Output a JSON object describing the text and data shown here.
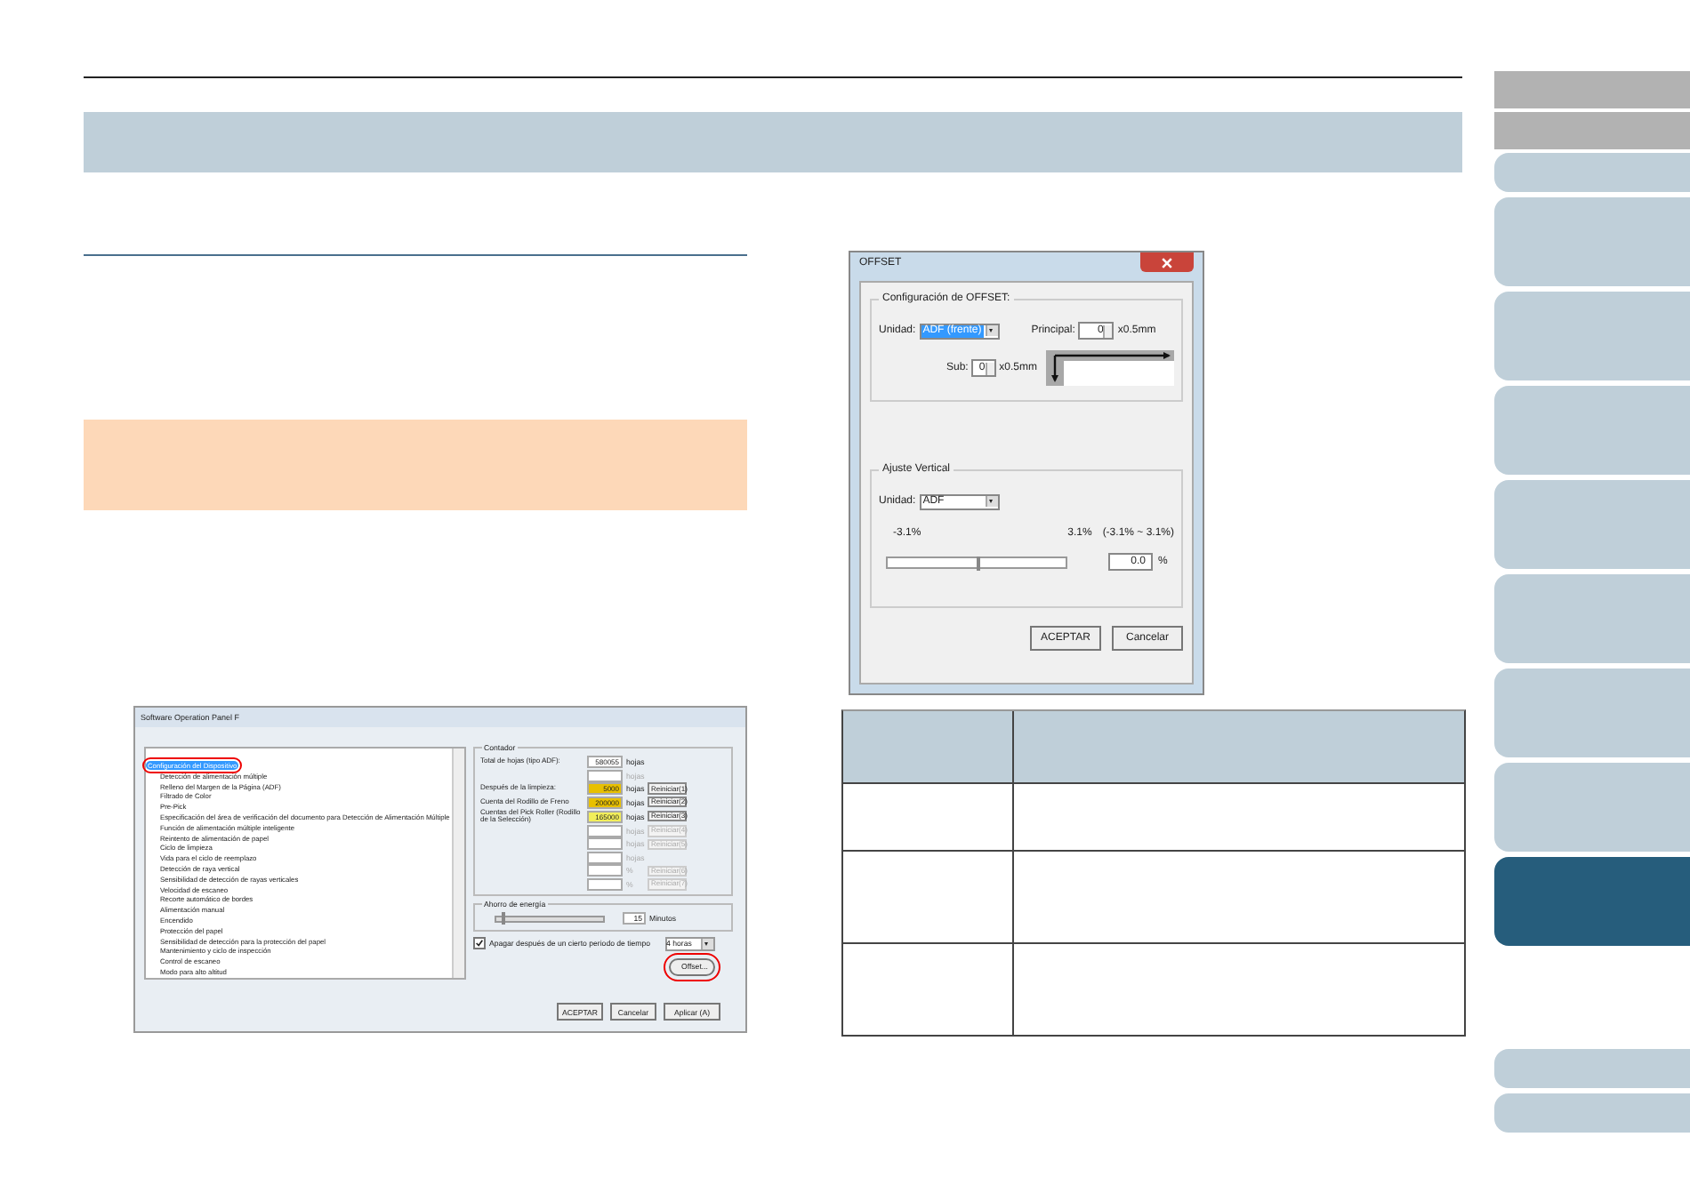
{
  "software_panel": {
    "title": "Software Operation Panel F",
    "tree": [
      {
        "label": "Configuración del Dispositivo",
        "selected": true,
        "circled": true,
        "children": [
          {
            "label": "Detección de alimentación múltiple",
            "selected": false
          },
          {
            "label": "Relleno del Margen de la Página (ADF)",
            "selected": false
          },
          {
            "label": "Filtrado de Color",
            "selected": false
          },
          {
            "label": "Pre-Pick",
            "selected": false
          },
          {
            "label": "Especificación del área de verificación del documento para Detección de Alimentación Múltiple",
            "selected": false
          },
          {
            "label": "Función de alimentación múltiple inteligente",
            "selected": false
          },
          {
            "label": "Reintento de alimentación de papel",
            "selected": false
          },
          {
            "label": "Ciclo de limpieza",
            "selected": false
          },
          {
            "label": "Vida para el ciclo de reemplazo",
            "selected": false
          },
          {
            "label": "Detección de raya vertical",
            "selected": false
          },
          {
            "label": "Sensibilidad de detección de rayas verticales",
            "selected": false
          },
          {
            "label": "Velocidad de escaneo",
            "selected": false
          },
          {
            "label": "Recorte automático de bordes",
            "selected": false
          },
          {
            "label": "Alimentación manual",
            "selected": false
          },
          {
            "label": "Encendido",
            "selected": false
          },
          {
            "label": "Protección del papel",
            "selected": false
          },
          {
            "label": "Sensibilidad de detección para la protección del papel",
            "selected": false
          },
          {
            "label": "Mantenimiento y ciclo de inspección",
            "selected": false
          },
          {
            "label": "Control de escaneo",
            "selected": false
          },
          {
            "label": "Modo para alto altitud",
            "selected": false
          }
        ]
      }
    ],
    "counter_group": {
      "title": "Contador",
      "rows": [
        {
          "label": "Total de hojas (tipo ADF):",
          "value": "580055",
          "unit": "hojas",
          "disabled": false
        },
        {
          "unit": "hojas",
          "disabled": true
        },
        {
          "label": "Después de la limpieza:",
          "value": "5000",
          "unit": "hojas",
          "button": "Reiniciar(1)",
          "color": "#e8c000",
          "disabled": false
        },
        {
          "label": "Cuenta del Rodillo de Freno",
          "value": "200000",
          "unit": "hojas",
          "button": "Reiniciar(2)",
          "color": "#e8c000",
          "disabled": false
        },
        {
          "label": "Cuentas del Pick Roller (Rodillo de la Selección)",
          "value": "165000",
          "unit": "hojas",
          "button": "Reiniciar(3)",
          "color": "#f2ee5a",
          "disabled": false
        },
        {
          "unit": "hojas",
          "button": "Reiniciar(4)",
          "disabled": true
        },
        {
          "unit": "hojas",
          "button": "Reiniciar(5)",
          "disabled": true
        },
        {
          "unit": "hojas",
          "disabled": true
        },
        {
          "unit": "%",
          "button": "Reiniciar(6)",
          "disabled": true
        },
        {
          "unit": "%",
          "button": "Reiniciar(7)",
          "disabled": true
        }
      ]
    },
    "energy_group": {
      "title": "Ahorro de energía",
      "level": 0.05,
      "value": "15",
      "unit": "Minutos"
    },
    "power_off": {
      "label": "Apagar después de un cierto periodo de tiempo",
      "checked": true,
      "value": "4 horas"
    },
    "offset_button": {
      "label": "Offset...",
      "circled": true
    },
    "buttons": [
      "ACEPTAR",
      "Cancelar",
      "Aplicar (A)"
    ]
  },
  "offset_dialog": {
    "title": "OFFSET",
    "offset_group": {
      "title": "Configuración de OFFSET:",
      "unit_label": "Unidad:",
      "unit_value": "ADF (frente)",
      "main_label": "Principal:",
      "main_value": "0",
      "main_unit": "x0.5mm",
      "sub_label": "Sub:",
      "sub_value": "0",
      "sub_unit": "x0.5mm"
    },
    "vertical_group": {
      "title": "Ajuste Vertical",
      "unit_label": "Unidad:",
      "unit_value": "ADF",
      "min": "-3.1%",
      "max": "3.1%",
      "range": "(-3.1% ~ 3.1%)",
      "level": 0.5,
      "value": "0.0",
      "value_unit": "%"
    },
    "buttons": [
      "ACEPTAR",
      "Cancelar"
    ]
  },
  "nav_tabs": [
    {
      "kind": "grey",
      "selected": false
    },
    {
      "kind": "grey",
      "selected": false
    },
    {
      "kind": "short",
      "selected": false
    },
    {
      "kind": "tall",
      "selected": false
    },
    {
      "kind": "tall",
      "selected": false
    },
    {
      "kind": "tall",
      "selected": false
    },
    {
      "kind": "tall",
      "selected": false
    },
    {
      "kind": "tall",
      "selected": false
    },
    {
      "kind": "tall",
      "selected": false
    },
    {
      "kind": "tall",
      "selected": false
    },
    {
      "kind": "tall",
      "selected": true
    },
    {
      "kind": "gap",
      "selected": false
    },
    {
      "kind": "short",
      "selected": false
    },
    {
      "kind": "short",
      "selected": false
    }
  ]
}
